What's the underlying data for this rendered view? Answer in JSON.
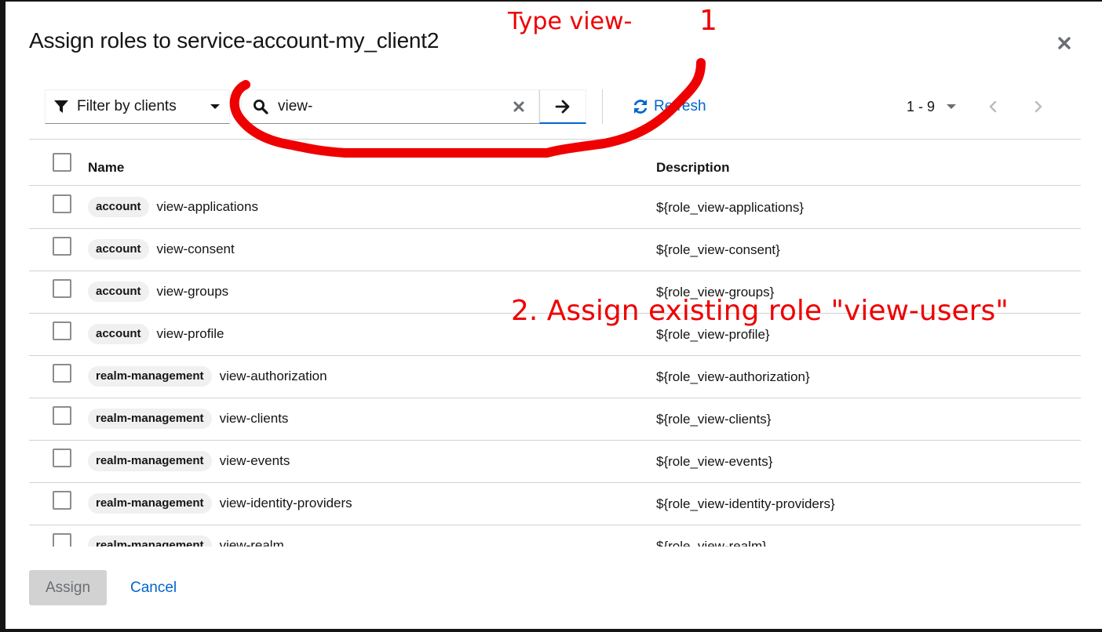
{
  "modal": {
    "title": "Assign roles to service-account-my_client2",
    "close_icon": "close-icon"
  },
  "toolbar": {
    "filter": {
      "label": "Filter by clients",
      "icon": "filter-icon",
      "caret": "caret-down-icon"
    },
    "search": {
      "value": "view-",
      "icon": "search-icon",
      "clear_icon": "clear-icon",
      "go_icon": "arrow-right-icon"
    },
    "refresh": {
      "label": "Refresh",
      "icon": "sync-icon"
    },
    "pagination": {
      "range": "1 - 9",
      "prev_icon": "angle-left-icon",
      "next_icon": "angle-right-icon"
    }
  },
  "table": {
    "headers": {
      "name": "Name",
      "description": "Description"
    },
    "rows": [
      {
        "client": "account",
        "name": "view-applications",
        "description": "${role_view-applications}"
      },
      {
        "client": "account",
        "name": "view-consent",
        "description": "${role_view-consent}"
      },
      {
        "client": "account",
        "name": "view-groups",
        "description": "${role_view-groups}"
      },
      {
        "client": "account",
        "name": "view-profile",
        "description": "${role_view-profile}"
      },
      {
        "client": "realm-management",
        "name": "view-authorization",
        "description": "${role_view-authorization}"
      },
      {
        "client": "realm-management",
        "name": "view-clients",
        "description": "${role_view-clients}"
      },
      {
        "client": "realm-management",
        "name": "view-events",
        "description": "${role_view-events}"
      },
      {
        "client": "realm-management",
        "name": "view-identity-providers",
        "description": "${role_view-identity-providers}"
      },
      {
        "client": "realm-management",
        "name": "view-realm",
        "description": "${role_view-realm}"
      }
    ]
  },
  "footer": {
    "assign_label": "Assign",
    "cancel_label": "Cancel"
  },
  "annotations": {
    "type_hint": "Type view-",
    "step_one": "1",
    "step_two": "2. Assign existing role \"view-users\"",
    "color": "#e00000"
  },
  "colors": {
    "link": "#0066cc",
    "badge_bg": "#f0f0f0",
    "disabled_bg": "#d2d2d2"
  }
}
